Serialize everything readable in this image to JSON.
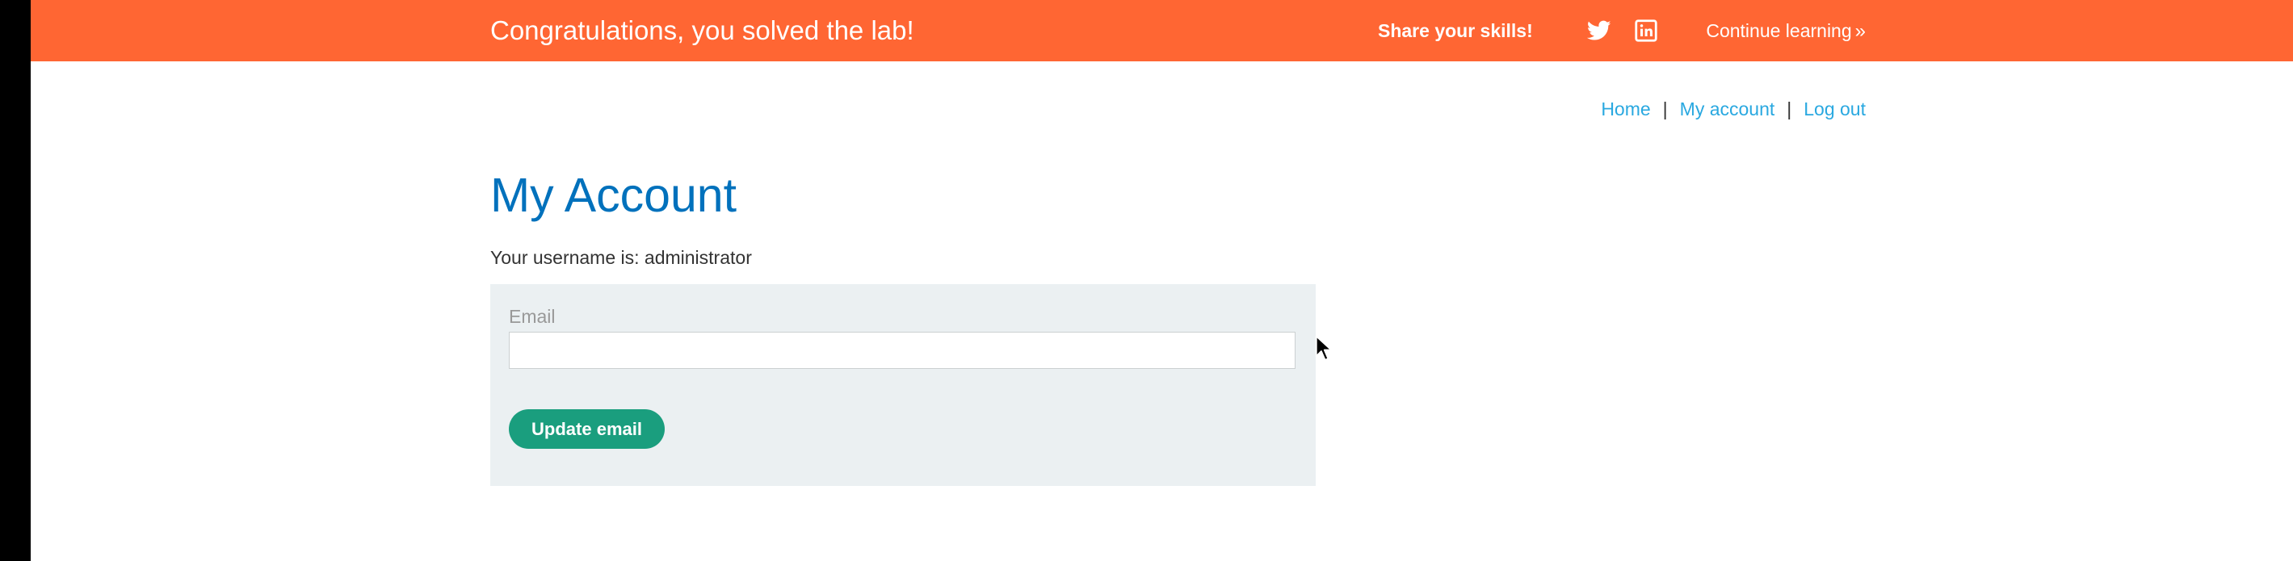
{
  "banner": {
    "title": "Congratulations, you solved the lab!",
    "share_label": "Share your skills!",
    "continue_label": "Continue learning",
    "continue_icon": "double-chevron-right-icon",
    "social_icons": [
      "twitter-icon",
      "linkedin-icon"
    ],
    "background_color": "#ff6633"
  },
  "nav": {
    "links": [
      "Home",
      "My account",
      "Log out"
    ],
    "separator": "|",
    "link_color": "#29a8e0"
  },
  "main": {
    "title": "My Account",
    "username_text": "Your username is: administrator",
    "title_color": "#0071bc"
  },
  "form": {
    "email_label": "Email",
    "email_value": "",
    "email_placeholder": "",
    "submit_label": "Update email",
    "button_color": "#1a9e7e",
    "panel_color": "#ebf0f2"
  }
}
